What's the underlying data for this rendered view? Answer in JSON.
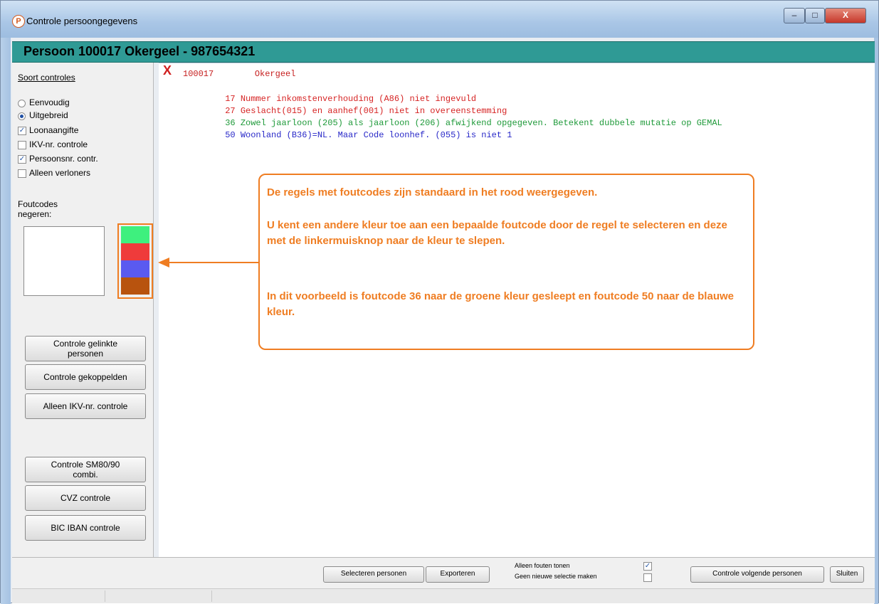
{
  "window": {
    "title": "Controle persoongegevens",
    "icon_letter": "P",
    "minimize": "–",
    "maximize": "□",
    "close": "X"
  },
  "header": {
    "title": "Persoon 100017 Okergeel - 987654321"
  },
  "sidebar": {
    "section_label": "Soort controles",
    "radio_options": [
      {
        "label": "Eenvoudig",
        "selected": false
      },
      {
        "label": "Uitgebreid",
        "selected": true
      }
    ],
    "checkboxes": [
      {
        "label": "Loonaangifte",
        "checked": true
      },
      {
        "label": "IKV-nr. controle",
        "checked": false
      },
      {
        "label": "Persoonsnr. contr.",
        "checked": true
      },
      {
        "label": "Alleen verloners",
        "checked": false
      }
    ],
    "ignore_label_1": "Foutcodes",
    "ignore_label_2": "negeren:",
    "color_swatches": [
      "#3ef07e",
      "#ef3b3b",
      "#5a5af0",
      "#b8530e"
    ],
    "buttons": [
      {
        "line1": "Controle gelinkte",
        "line2": "personen"
      },
      {
        "line1": "Controle gekoppelden",
        "line2": ""
      },
      {
        "line1": "Alleen IKV-nr. controle",
        "line2": ""
      },
      {
        "line1": "Controle SM80/90",
        "line2": "combi."
      },
      {
        "line1": "CVZ controle",
        "line2": ""
      },
      {
        "line1": "BIC IBAN controle",
        "line2": ""
      }
    ]
  },
  "output": {
    "marker": "X",
    "person_line": "100017        Okergeel",
    "lines": [
      {
        "code": "17",
        "text": "Nummer inkomstenverhouding (A86) niet ingevuld",
        "color": "#d62424"
      },
      {
        "code": "27",
        "text": "Geslacht(015) en aanhef(001) niet in overeenstemming",
        "color": "#d62424"
      },
      {
        "code": "36",
        "text": "Zowel jaarloon (205) als jaarloon (206) afwijkend opgegeven. Betekent dubbele mutatie op GEMAL",
        "color": "#1f9a3a"
      },
      {
        "code": "50",
        "text": "Woonland (B36)=NL. Maar Code loonhef. (055) is niet 1",
        "color": "#2828c8"
      }
    ]
  },
  "callout": {
    "p1": "De regels met foutcodes zijn standaard in het rood weergegeven.",
    "p2": "U kent een andere kleur toe aan een bepaalde foutcode door de regel te selecteren en deze met de linkermuisknop naar de kleur te slepen.",
    "p3": "In dit voorbeeld is foutcode 36 naar de groene kleur gesleept en foutcode 50 naar de blauwe kleur."
  },
  "bottombar": {
    "select_button": "Selecteren personen",
    "export_button": "Exporteren",
    "only_errors_label": "Alleen fouten tonen",
    "only_errors_checked": true,
    "no_new_selection_label": "Geen nieuwe selectie maken",
    "no_new_selection_checked": false,
    "next_button": "Controle volgende personen",
    "close_button": "Sluiten"
  }
}
